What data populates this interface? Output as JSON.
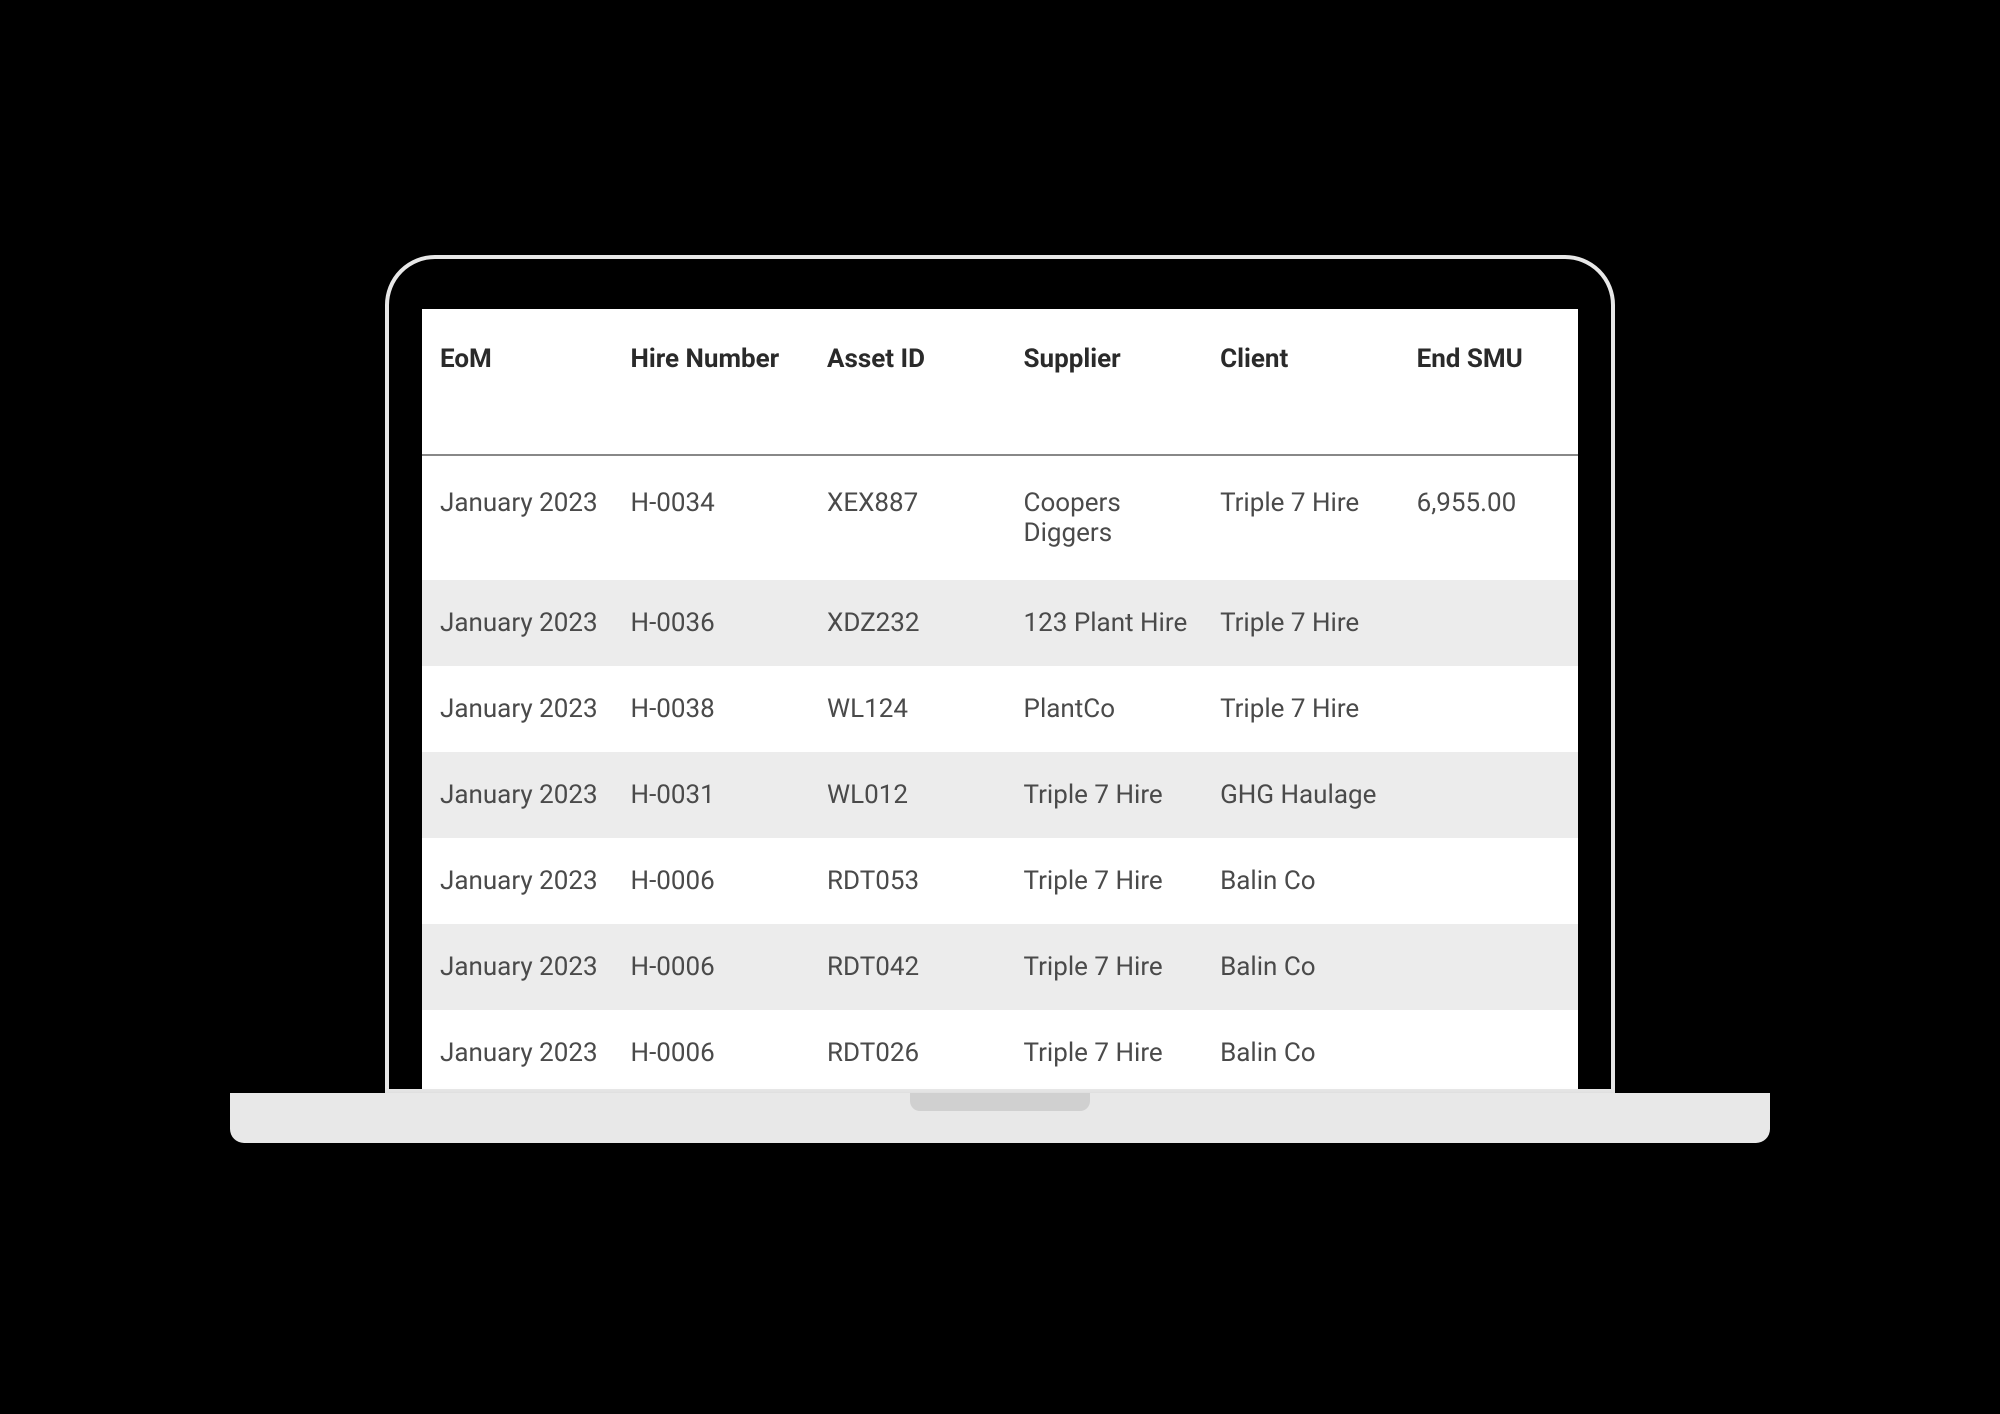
{
  "table": {
    "headers": {
      "eom": "EoM",
      "hire_number": "Hire Number",
      "asset_id": "Asset ID",
      "supplier": "Supplier",
      "client": "Client",
      "end_smu": "End SMU"
    },
    "rows": [
      {
        "eom": "January 2023",
        "hire_number": "H-0034",
        "asset_id": "XEX887",
        "supplier": "Coopers Diggers",
        "client": "Triple 7 Hire",
        "end_smu": "6,955.00"
      },
      {
        "eom": "January 2023",
        "hire_number": "H-0036",
        "asset_id": "XDZ232",
        "supplier": "123 Plant Hire",
        "client": "Triple 7 Hire",
        "end_smu": ""
      },
      {
        "eom": "January 2023",
        "hire_number": "H-0038",
        "asset_id": "WL124",
        "supplier": "PlantCo",
        "client": "Triple 7 Hire",
        "end_smu": ""
      },
      {
        "eom": "January 2023",
        "hire_number": "H-0031",
        "asset_id": "WL012",
        "supplier": "Triple 7 Hire",
        "client": "GHG Haulage",
        "end_smu": ""
      },
      {
        "eom": "January 2023",
        "hire_number": "H-0006",
        "asset_id": "RDT053",
        "supplier": "Triple 7 Hire",
        "client": "Balin Co",
        "end_smu": ""
      },
      {
        "eom": "January 2023",
        "hire_number": "H-0006",
        "asset_id": "RDT042",
        "supplier": "Triple 7 Hire",
        "client": "Balin Co",
        "end_smu": ""
      },
      {
        "eom": "January 2023",
        "hire_number": "H-0006",
        "asset_id": "RDT026",
        "supplier": "Triple 7 Hire",
        "client": "Balin Co",
        "end_smu": ""
      }
    ]
  }
}
